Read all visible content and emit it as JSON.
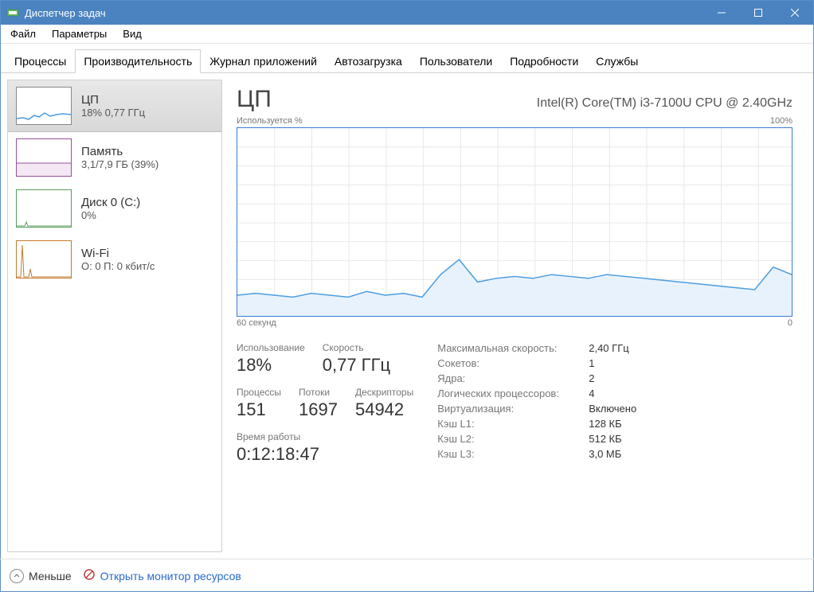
{
  "window": {
    "title": "Диспетчер задач"
  },
  "menu": {
    "file": "Файл",
    "options": "Параметры",
    "view": "Вид"
  },
  "tabs": {
    "processes": "Процессы",
    "performance": "Производительность",
    "app_history": "Журнал приложений",
    "startup": "Автозагрузка",
    "users": "Пользователи",
    "details": "Подробности",
    "services": "Службы"
  },
  "sidebar": {
    "items": [
      {
        "title": "ЦП",
        "sub": "18% 0,77 ГГц"
      },
      {
        "title": "Память",
        "sub": "3,1/7,9 ГБ (39%)"
      },
      {
        "title": "Диск 0 (C:)",
        "sub": "0%"
      },
      {
        "title": "Wi-Fi",
        "sub": "О: 0 П: 0 кбит/с"
      }
    ]
  },
  "main": {
    "title": "ЦП",
    "subtitle": "Intel(R) Core(TM) i3-7100U CPU @ 2.40GHz",
    "chart_top_left": "Используется %",
    "chart_top_right": "100%",
    "chart_bottom_left": "60 секунд",
    "chart_bottom_right": "0"
  },
  "stats": {
    "utilization_label": "Использование",
    "utilization_value": "18%",
    "speed_label": "Скорость",
    "speed_value": "0,77 ГГц",
    "processes_label": "Процессы",
    "processes_value": "151",
    "threads_label": "Потоки",
    "threads_value": "1697",
    "handles_label": "Дескрипторы",
    "handles_value": "54942",
    "uptime_label": "Время работы",
    "uptime_value": "0:12:18:47"
  },
  "info": {
    "max_speed_label": "Максимальная скорость:",
    "max_speed_value": "2,40 ГГц",
    "sockets_label": "Сокетов:",
    "sockets_value": "1",
    "cores_label": "Ядра:",
    "cores_value": "2",
    "logical_label": "Логических процессоров:",
    "logical_value": "4",
    "virt_label": "Виртуализация:",
    "virt_value": "Включено",
    "l1_label": "Кэш L1:",
    "l1_value": "128 КБ",
    "l2_label": "Кэш L2:",
    "l2_value": "512 КБ",
    "l3_label": "Кэш L3:",
    "l3_value": "3,0 МБ"
  },
  "footer": {
    "less": "Меньше",
    "open_monitor": "Открыть монитор ресурсов"
  },
  "chart_data": {
    "type": "line",
    "title": "Используется %",
    "xlabel": "60 секунд",
    "ylabel": "",
    "ylim": [
      0,
      100
    ],
    "x_seconds_ago": [
      60,
      58,
      56,
      54,
      52,
      50,
      48,
      46,
      44,
      42,
      40,
      38,
      36,
      34,
      32,
      30,
      28,
      26,
      24,
      22,
      20,
      18,
      16,
      14,
      12,
      10,
      8,
      6,
      4,
      2,
      0
    ],
    "values": [
      11,
      12,
      11,
      10,
      12,
      11,
      10,
      13,
      11,
      12,
      10,
      22,
      30,
      18,
      20,
      21,
      20,
      22,
      21,
      20,
      22,
      21,
      20,
      19,
      18,
      17,
      16,
      15,
      14,
      26,
      22
    ]
  }
}
